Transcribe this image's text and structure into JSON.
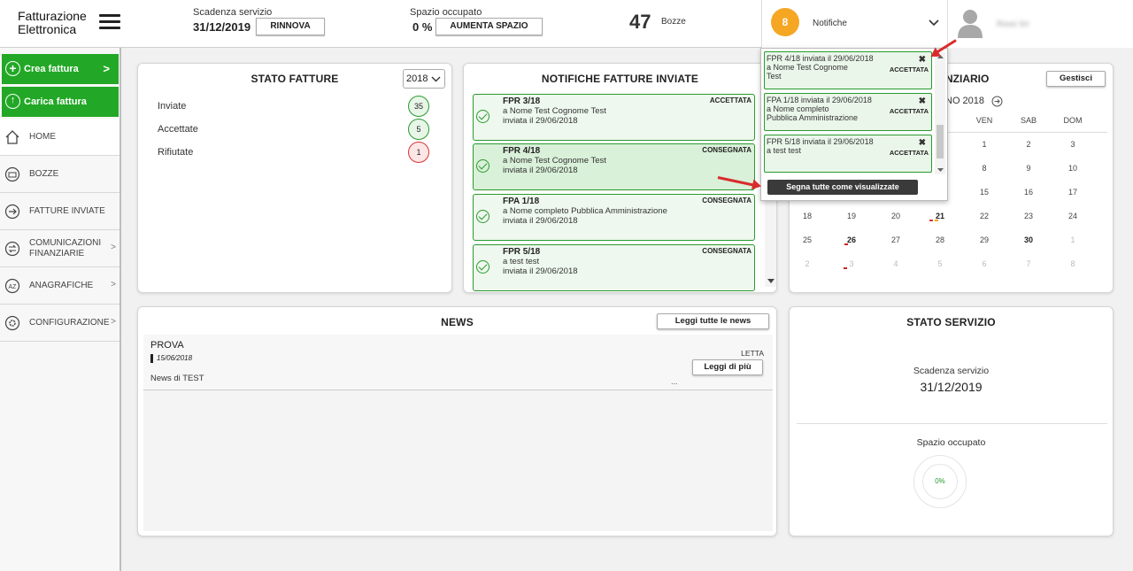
{
  "header": {
    "app_title_line1": "Fatturazione",
    "app_title_line2": "Elettronica",
    "scadenza_label": "Scadenza servizio",
    "scadenza_value": "31/12/2019",
    "rinnova_label": "RINNOVA",
    "spazio_label": "Spazio occupato",
    "spazio_value": "0 %",
    "aumenta_label": "AUMENTA SPAZIO",
    "bozze_count": "47",
    "bozze_label": "Bozze",
    "notif_count": "8",
    "notif_label": "Notifiche",
    "user_name": "Rossi Srl"
  },
  "sidebar": {
    "crea_label": "Crea fattura",
    "carica_label": "Carica fattura",
    "items": [
      {
        "label": "HOME"
      },
      {
        "label": "BOZZE"
      },
      {
        "label": "FATTURE INVIATE"
      },
      {
        "label": "COMUNICAZIONI FINANZIARIE",
        "line1": "COMUNICAZIONI",
        "line2": "FINANZIARIE"
      },
      {
        "label": "ANAGRAFICHE"
      },
      {
        "label": "CONFIGURAZIONE"
      }
    ]
  },
  "stato_fatture": {
    "title": "STATO FATTURE",
    "year": "2018",
    "rows": [
      {
        "label": "Inviate",
        "count": "35"
      },
      {
        "label": "Accettate",
        "count": "5"
      },
      {
        "label": "Rifiutate",
        "count": "1"
      }
    ]
  },
  "notifiche_inviate": {
    "title": "NOTIFICHE FATTURE INVIATE",
    "items": [
      {
        "id": "FPR 3/18",
        "to": "a Nome Test Cognome Test",
        "date": "inviata il 29/06/2018",
        "status": "ACCETTATA"
      },
      {
        "id": "FPR 4/18",
        "to": "a Nome Test Cognome Test",
        "date": "inviata il 29/06/2018",
        "status": "CONSEGNATA"
      },
      {
        "id": "FPA 1/18",
        "to": "a Nome completo Pubblica Amministrazione",
        "date": "inviata il 29/06/2018",
        "status": "CONSEGNATA"
      },
      {
        "id": "FPR 5/18",
        "to": "a test test",
        "date": "inviata il 29/06/2018",
        "status": "CONSEGNATA"
      }
    ]
  },
  "calendar": {
    "title_visible": "NZIARIO",
    "gestisci_label": "Gestisci",
    "month_visible": "NO 2018",
    "days": [
      "VEN",
      "SAB",
      "DOM"
    ],
    "rows": [
      [
        "",
        "",
        "",
        "",
        "1",
        "2",
        "3"
      ],
      [
        "",
        "",
        "",
        "",
        "8",
        "9",
        "10"
      ],
      [
        "",
        "",
        "",
        "",
        "15",
        "16",
        "17"
      ],
      [
        "18",
        "19",
        "20",
        "21",
        "22",
        "23",
        "24"
      ],
      [
        "25",
        "26",
        "27",
        "28",
        "29",
        "30",
        "1"
      ],
      [
        "2",
        "3",
        "4",
        "5",
        "6",
        "7",
        "8"
      ]
    ]
  },
  "news": {
    "title": "NEWS",
    "read_all_label": "Leggi tutte le news",
    "item_title": "PROVA",
    "item_date": "15/06/2018",
    "item_status": "LETTA",
    "item_more_label": "Leggi di più",
    "item_body": "News di TEST",
    "item_ellipsis": "..."
  },
  "stato_servizio": {
    "title": "STATO SERVIZIO",
    "scadenza_label": "Scadenza servizio",
    "scadenza_value": "31/12/2019",
    "spazio_label": "Spazio occupato",
    "spazio_value": "0%"
  },
  "notif_dropdown": {
    "items": [
      {
        "line1": "FPR 4/18 inviata il 29/06/2018",
        "line2": "a Nome Test Cognome",
        "line3": "Test",
        "status": "ACCETTATA"
      },
      {
        "line1": "FPA 1/18 inviata il 29/06/2018",
        "line2": "a Nome completo",
        "line3": "Pubblica Amministrazione",
        "status": "ACCETTATA"
      },
      {
        "line1": "FPR 5/18 inviata il 29/06/2018",
        "line2": "a test test",
        "line3": "",
        "status": "ACCETTATA"
      }
    ],
    "close_symbol": "✖",
    "mark_all_label": "Segna tutte come visualizzate"
  },
  "colors": {
    "green": "#22a826",
    "orange": "#f5a623",
    "annotation_red": "#d92b2b"
  }
}
